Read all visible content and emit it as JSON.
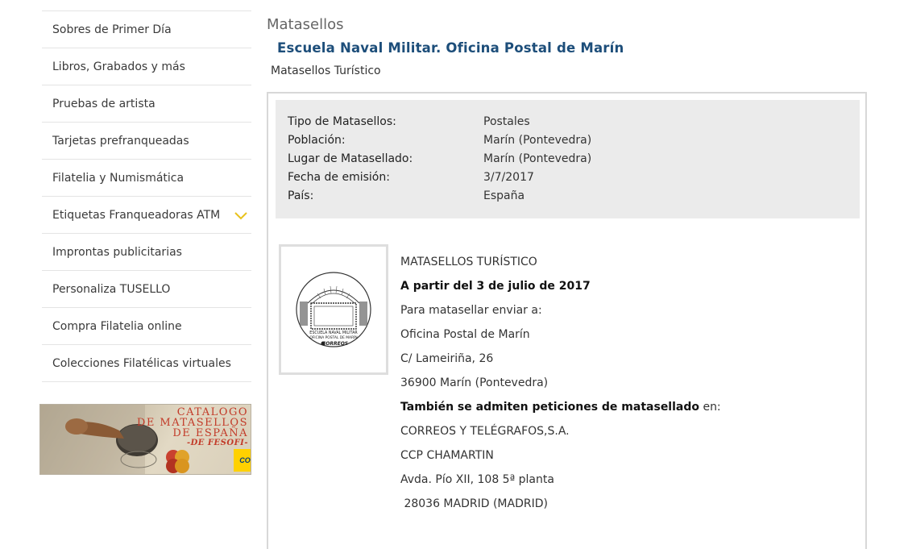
{
  "sidebar": {
    "items": [
      {
        "label": "Sobres de Primer Día"
      },
      {
        "label": "Libros, Grabados y más"
      },
      {
        "label": "Pruebas de artista"
      },
      {
        "label": "Tarjetas prefranqueadas"
      },
      {
        "label": "Filatelia y Numismática"
      },
      {
        "label": "Etiquetas Franqueadoras ATM"
      },
      {
        "label": "Improntas publicitarias"
      },
      {
        "label": "Personaliza TUSELLO"
      },
      {
        "label": "Compra Filatelia online"
      },
      {
        "label": "Colecciones Filatélicas virtuales"
      }
    ],
    "expand_icon": "chevron-down-icon",
    "expand_icon_color": "#e8c21c",
    "banner": {
      "line1": "CATALOGO",
      "line2": "DE MATASELLOS",
      "line3": "DE ESPAÑA",
      "line4": "-DE FESOFI-",
      "logo": "CORREOS"
    }
  },
  "main": {
    "section_title": "Matasellos",
    "title": "Escuela Naval Militar. Oficina Postal de Marín",
    "subtitle": "Matasellos Turístico",
    "details": [
      {
        "key": "Tipo de Matasellos:",
        "value": "Postales"
      },
      {
        "key": "Población:",
        "value": "Marín (Pontevedra)"
      },
      {
        "key": "Lugar de Matasellado:",
        "value": "Marín (Pontevedra)"
      },
      {
        "key": "Fecha de emisión:",
        "value": "3/7/2017"
      },
      {
        "key": "País:",
        "value": "España"
      }
    ],
    "stamp": {
      "text_line1": "ESCUELA NAVAL MILITAR",
      "text_line2": "OFICINA POSTAL DE MARÍN",
      "logo": "CORREOS"
    },
    "description": {
      "l1": "MATASELLOS TURÍSTICO",
      "l2": "A partir del 3 de julio de 2017",
      "l3": "Para matasellar enviar a:",
      "l4": "Oficina Postal de Marín",
      "l5": "C/ Lameiriña, 26",
      "l6": "36900 Marín (Pontevedra)",
      "l7_bold": "También se admiten peticiones de matasellado",
      "l7_rest": " en:",
      "l8": "CORREOS Y TELÉGRAFOS,S.A.",
      "l9": "CCP CHAMARTIN",
      "l10": "Avda. Pío XII, 108 5ª planta",
      "l11": " 28036 MADRID (MADRID)"
    }
  },
  "colors": {
    "title_blue": "#1d4e7a",
    "info_bg": "#ebebeb",
    "banner_red": "#c23a28"
  }
}
